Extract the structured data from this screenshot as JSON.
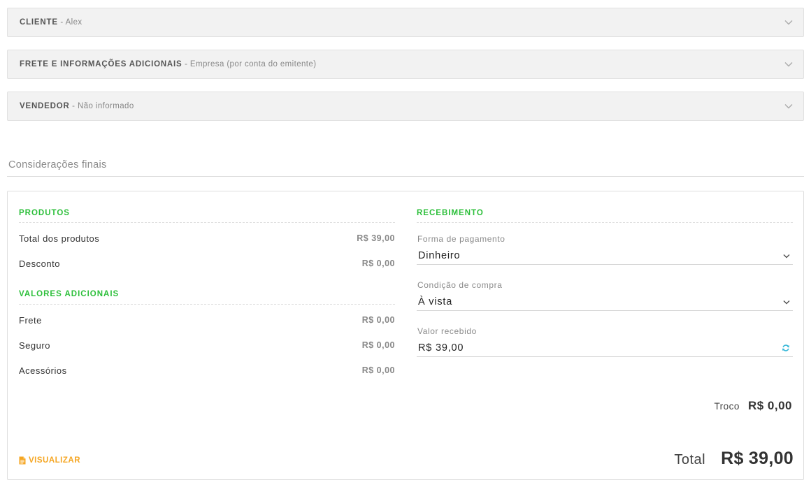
{
  "accordions": [
    {
      "title": "CLIENTE",
      "subtitle": " - Alex"
    },
    {
      "title": "FRETE E INFORMAÇÕES ADICIONAIS",
      "subtitle": " - Empresa (por conta do emitente)"
    },
    {
      "title": "VENDEDOR",
      "subtitle": " - Não informado"
    }
  ],
  "section_title": "Considerações finais",
  "produtos": {
    "heading": "PRODUTOS",
    "rows": [
      {
        "label": "Total dos produtos",
        "value": "R$ 39,00"
      },
      {
        "label": "Desconto",
        "value": "R$ 0,00"
      }
    ]
  },
  "valores_adicionais": {
    "heading": "VALORES ADICIONAIS",
    "rows": [
      {
        "label": "Frete",
        "value": "R$ 0,00"
      },
      {
        "label": "Seguro",
        "value": "R$ 0,00"
      },
      {
        "label": "Acessórios",
        "value": "R$ 0,00"
      }
    ]
  },
  "recebimento": {
    "heading": "RECEBIMENTO",
    "forma_pagamento": {
      "label": "Forma de pagamento",
      "value": "Dinheiro"
    },
    "condicao_compra": {
      "label": "Condição de compra",
      "value": "À vista"
    },
    "valor_recebido": {
      "label": "Valor recebido",
      "value": "R$ 39,00"
    }
  },
  "troco": {
    "label": "Troco",
    "value": "R$ 0,00"
  },
  "total": {
    "label": "Total",
    "value": "R$ 39,00"
  },
  "visualizar_label": "VISUALIZAR",
  "colors": {
    "accent_green": "#2cbf3a",
    "accent_orange": "#f5a623",
    "refresh_icon": "#3bb9d9"
  },
  "icons": {
    "accordion_toggle": "chevron-down-icon",
    "select_toggle": "chevron-down-icon",
    "refresh": "refresh-icon",
    "document": "document-icon"
  }
}
